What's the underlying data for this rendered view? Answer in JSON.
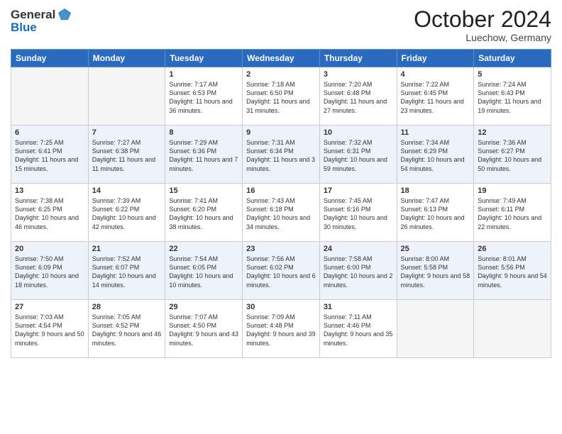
{
  "header": {
    "logo_line1": "General",
    "logo_line2": "Blue",
    "month": "October 2024",
    "location": "Luechow, Germany"
  },
  "days_of_week": [
    "Sunday",
    "Monday",
    "Tuesday",
    "Wednesday",
    "Thursday",
    "Friday",
    "Saturday"
  ],
  "weeks": [
    [
      {
        "num": "",
        "text": ""
      },
      {
        "num": "",
        "text": ""
      },
      {
        "num": "1",
        "text": "Sunrise: 7:17 AM\nSunset: 6:53 PM\nDaylight: 11 hours and 36 minutes."
      },
      {
        "num": "2",
        "text": "Sunrise: 7:18 AM\nSunset: 6:50 PM\nDaylight: 11 hours and 31 minutes."
      },
      {
        "num": "3",
        "text": "Sunrise: 7:20 AM\nSunset: 6:48 PM\nDaylight: 11 hours and 27 minutes."
      },
      {
        "num": "4",
        "text": "Sunrise: 7:22 AM\nSunset: 6:45 PM\nDaylight: 11 hours and 23 minutes."
      },
      {
        "num": "5",
        "text": "Sunrise: 7:24 AM\nSunset: 6:43 PM\nDaylight: 11 hours and 19 minutes."
      }
    ],
    [
      {
        "num": "6",
        "text": "Sunrise: 7:25 AM\nSunset: 6:41 PM\nDaylight: 11 hours and 15 minutes."
      },
      {
        "num": "7",
        "text": "Sunrise: 7:27 AM\nSunset: 6:38 PM\nDaylight: 11 hours and 11 minutes."
      },
      {
        "num": "8",
        "text": "Sunrise: 7:29 AM\nSunset: 6:36 PM\nDaylight: 11 hours and 7 minutes."
      },
      {
        "num": "9",
        "text": "Sunrise: 7:31 AM\nSunset: 6:34 PM\nDaylight: 11 hours and 3 minutes."
      },
      {
        "num": "10",
        "text": "Sunrise: 7:32 AM\nSunset: 6:31 PM\nDaylight: 10 hours and 59 minutes."
      },
      {
        "num": "11",
        "text": "Sunrise: 7:34 AM\nSunset: 6:29 PM\nDaylight: 10 hours and 54 minutes."
      },
      {
        "num": "12",
        "text": "Sunrise: 7:36 AM\nSunset: 6:27 PM\nDaylight: 10 hours and 50 minutes."
      }
    ],
    [
      {
        "num": "13",
        "text": "Sunrise: 7:38 AM\nSunset: 6:25 PM\nDaylight: 10 hours and 46 minutes."
      },
      {
        "num": "14",
        "text": "Sunrise: 7:39 AM\nSunset: 6:22 PM\nDaylight: 10 hours and 42 minutes."
      },
      {
        "num": "15",
        "text": "Sunrise: 7:41 AM\nSunset: 6:20 PM\nDaylight: 10 hours and 38 minutes."
      },
      {
        "num": "16",
        "text": "Sunrise: 7:43 AM\nSunset: 6:18 PM\nDaylight: 10 hours and 34 minutes."
      },
      {
        "num": "17",
        "text": "Sunrise: 7:45 AM\nSunset: 6:16 PM\nDaylight: 10 hours and 30 minutes."
      },
      {
        "num": "18",
        "text": "Sunrise: 7:47 AM\nSunset: 6:13 PM\nDaylight: 10 hours and 26 minutes."
      },
      {
        "num": "19",
        "text": "Sunrise: 7:49 AM\nSunset: 6:11 PM\nDaylight: 10 hours and 22 minutes."
      }
    ],
    [
      {
        "num": "20",
        "text": "Sunrise: 7:50 AM\nSunset: 6:09 PM\nDaylight: 10 hours and 18 minutes."
      },
      {
        "num": "21",
        "text": "Sunrise: 7:52 AM\nSunset: 6:07 PM\nDaylight: 10 hours and 14 minutes."
      },
      {
        "num": "22",
        "text": "Sunrise: 7:54 AM\nSunset: 6:05 PM\nDaylight: 10 hours and 10 minutes."
      },
      {
        "num": "23",
        "text": "Sunrise: 7:56 AM\nSunset: 6:02 PM\nDaylight: 10 hours and 6 minutes."
      },
      {
        "num": "24",
        "text": "Sunrise: 7:58 AM\nSunset: 6:00 PM\nDaylight: 10 hours and 2 minutes."
      },
      {
        "num": "25",
        "text": "Sunrise: 8:00 AM\nSunset: 5:58 PM\nDaylight: 9 hours and 58 minutes."
      },
      {
        "num": "26",
        "text": "Sunrise: 8:01 AM\nSunset: 5:56 PM\nDaylight: 9 hours and 54 minutes."
      }
    ],
    [
      {
        "num": "27",
        "text": "Sunrise: 7:03 AM\nSunset: 4:54 PM\nDaylight: 9 hours and 50 minutes."
      },
      {
        "num": "28",
        "text": "Sunrise: 7:05 AM\nSunset: 4:52 PM\nDaylight: 9 hours and 46 minutes."
      },
      {
        "num": "29",
        "text": "Sunrise: 7:07 AM\nSunset: 4:50 PM\nDaylight: 9 hours and 43 minutes."
      },
      {
        "num": "30",
        "text": "Sunrise: 7:09 AM\nSunset: 4:48 PM\nDaylight: 9 hours and 39 minutes."
      },
      {
        "num": "31",
        "text": "Sunrise: 7:11 AM\nSunset: 4:46 PM\nDaylight: 9 hours and 35 minutes."
      },
      {
        "num": "",
        "text": ""
      },
      {
        "num": "",
        "text": ""
      }
    ]
  ]
}
